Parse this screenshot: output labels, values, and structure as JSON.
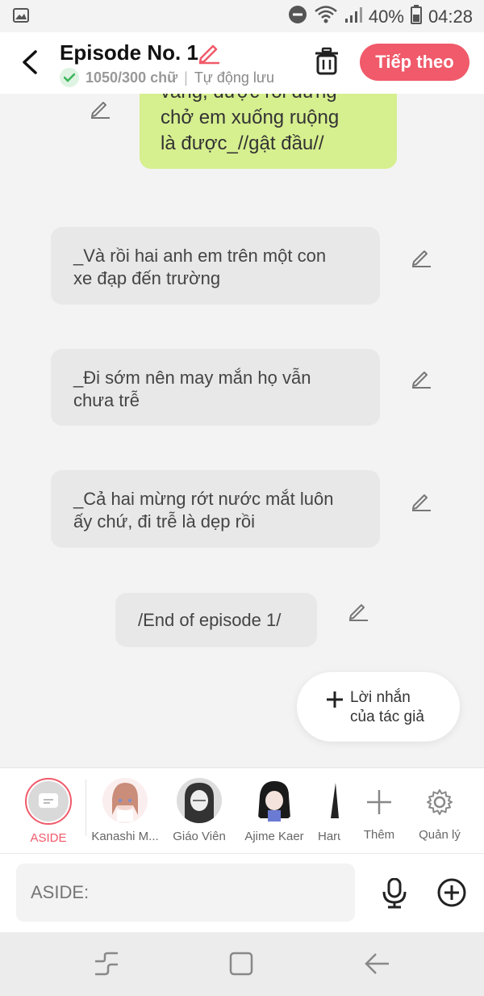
{
  "status": {
    "battery": "40%",
    "time": "04:28"
  },
  "header": {
    "title": "Episode No. 1",
    "char_count": "1050/300 chữ",
    "separator": "|",
    "autosave": "Tự động lưu",
    "next_label": "Tiếp theo"
  },
  "messages": {
    "green_line1": "vâng, được rồi đừng",
    "green_line2": "chở em xuống ruộng",
    "green_line3": "là được_//gật đầu//",
    "m1_line1": "_Và rồi hai anh em trên một con",
    "m1_line2": "xe đạp đến trường",
    "m2_line1": "_Đi sớm nên may mắn họ vẫn",
    "m2_line2": "chưa trễ",
    "m3_line1": "_Cả hai mừng rớt nước mắt luôn",
    "m3_line2": "ấy chứ, đi trễ là dẹp rồi",
    "end_text": "/End of episode 1/"
  },
  "fab": {
    "line1": "Lời nhắn",
    "line2": "của tác giả"
  },
  "cast": {
    "aside": "ASIDE",
    "c1": "Kanashi M...",
    "c2": "Giáo Viên",
    "c3": "Ajime Kaer",
    "c4": "Haru",
    "add": "Thêm",
    "manage": "Quản lý"
  },
  "input": {
    "placeholder": "ASIDE:"
  },
  "colors": {
    "accent": "#f05a6a",
    "green_bubble": "#d6ef8f",
    "gray_bubble": "#e8e8e8"
  }
}
